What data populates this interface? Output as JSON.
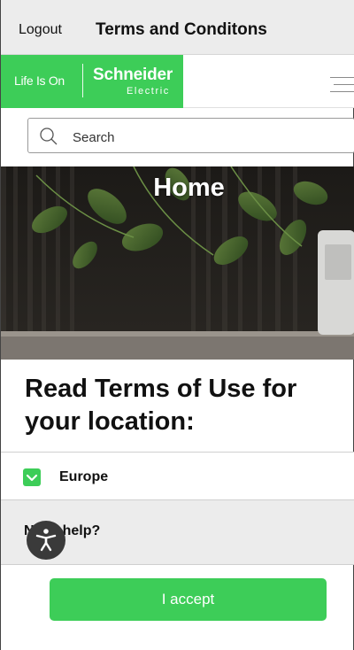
{
  "header": {
    "logout_label": "Logout",
    "title": "Terms and Conditons"
  },
  "brand": {
    "tagline": "Life Is On",
    "name": "Schneider",
    "sub": "Electric",
    "color": "#3dcd58"
  },
  "menu": {
    "icon": "hamburger-menu-icon"
  },
  "search": {
    "placeholder": "Search",
    "value": "",
    "icon": "search-icon"
  },
  "hero": {
    "title": "Home"
  },
  "main": {
    "heading": "Read Terms of Use for your location:",
    "location": {
      "label": "Europe",
      "icon": "chevron-down-icon"
    },
    "help_label": "Need help?",
    "accept_label": "I accept"
  },
  "accessibility": {
    "icon": "accessibility-icon"
  },
  "colors": {
    "accent": "#3dcd58",
    "header_bg": "#ececec",
    "text": "#111111"
  }
}
